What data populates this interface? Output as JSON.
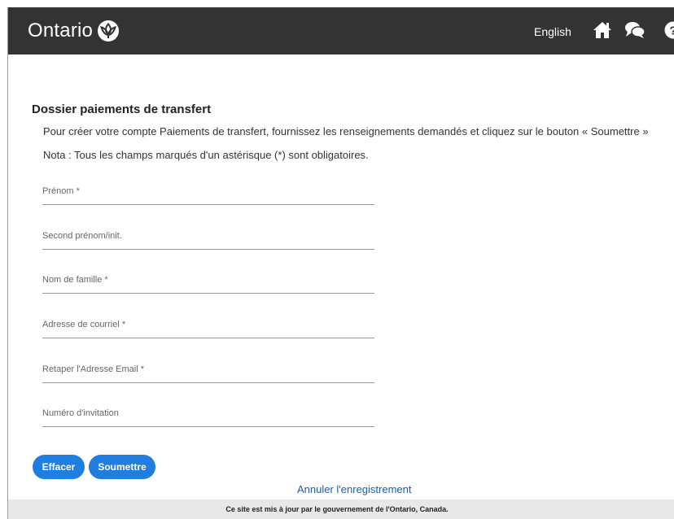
{
  "header": {
    "brand_name": "Ontario",
    "language_link": "English",
    "icons": [
      "trillium-logo-icon",
      "home-icon",
      "chat-icon",
      "help-icon"
    ],
    "background_color": "#333333"
  },
  "main": {
    "title": "Dossier paiements de transfert",
    "intro": "Pour créer votre compte Paiements de transfert, fournissez les renseignements demandés et cliquez sur le bouton « Soumettre »",
    "note": "Nota : Tous les champs marqués d'un astérisque (*) sont obligatoires.",
    "fields": {
      "first_name": {
        "placeholder": "Prénom *",
        "value": ""
      },
      "middle_name": {
        "placeholder": "Second prénom/init.",
        "value": ""
      },
      "last_name": {
        "placeholder": "Nom de famille *",
        "value": ""
      },
      "email": {
        "placeholder": "Adresse de courriel *",
        "value": ""
      },
      "email_confirm": {
        "placeholder": "Retaper l'Adresse Email *",
        "value": ""
      },
      "invitation_number": {
        "placeholder": "Numéro d'invitation",
        "value": ""
      }
    },
    "buttons": {
      "clear_label": "Effacer",
      "submit_label": "Soumettre"
    },
    "cancel_link": "Annuler l'enregistrement",
    "accent_color": "#1f7ee0"
  },
  "footer": {
    "text": "Ce site est mis à jour par le gouvernement de l'Ontario, Canada."
  }
}
